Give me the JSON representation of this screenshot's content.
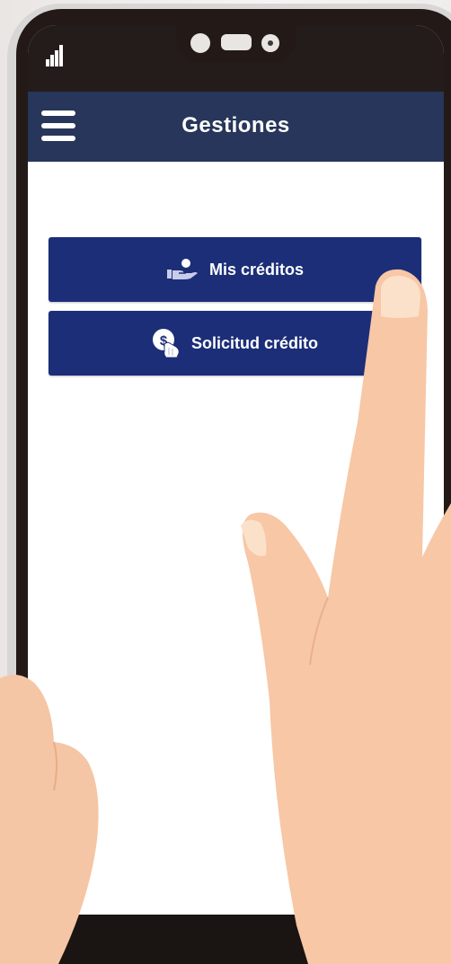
{
  "status_bar": {
    "signal_icon": "signal-bars-icon"
  },
  "header": {
    "title": "Gestiones",
    "menu_icon": "hamburger-menu-icon"
  },
  "actions": [
    {
      "label": "Mis créditos",
      "icon": "hand-holding-coin-icon"
    },
    {
      "label": "Solicitud crédito",
      "icon": "dollar-coin-hand-icon"
    }
  ],
  "colors": {
    "header_bg": "#27365a",
    "button_bg": "#1c2e78",
    "screen_bg": "#ffffff",
    "phone_frame": "#231a17",
    "skin": "#f7c7a6"
  }
}
